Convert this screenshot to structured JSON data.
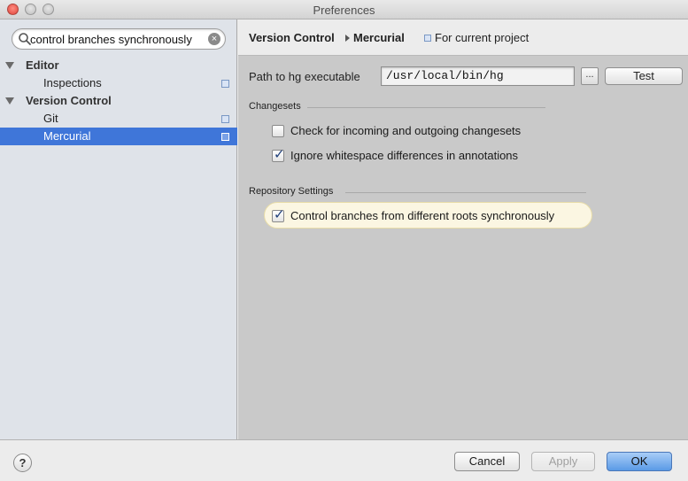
{
  "window": {
    "title": "Preferences"
  },
  "search": {
    "value": "control branches synchronously",
    "icon": "search-icon"
  },
  "tree": {
    "items": [
      {
        "label": "Editor",
        "level": 0,
        "expanded": true
      },
      {
        "label": "Inspections",
        "level": 1,
        "project_icon": true
      },
      {
        "label": "Version Control",
        "level": 0,
        "expanded": true
      },
      {
        "label": "Git",
        "level": 1,
        "project_icon": true
      },
      {
        "label": "Mercurial",
        "level": 1,
        "project_icon": true,
        "selected": true
      }
    ]
  },
  "header": {
    "breadcrumb_parent": "Version Control",
    "breadcrumb_current": "Mercurial",
    "scope": "For current project"
  },
  "hg": {
    "path_label": "Path to hg executable",
    "path_value": "/usr/local/bin/hg",
    "browse_label": "...",
    "test_label": "Test"
  },
  "changesets": {
    "title": "Changesets",
    "incoming_label": "Check for incoming and outgoing changesets",
    "incoming_checked": false,
    "whitespace_label": "Ignore whitespace differences in annotations",
    "whitespace_checked": true
  },
  "repository": {
    "title": "Repository Settings",
    "sync_label": "Control branches from different roots synchronously",
    "sync_checked": true
  },
  "footer": {
    "help_label": "?",
    "cancel_label": "Cancel",
    "apply_label": "Apply",
    "ok_label": "OK"
  },
  "colors": {
    "selection": "#3f76d9",
    "sidebar": "#dfe3e9",
    "panel": "#c9c9c9",
    "highlight": "#fbf6e2",
    "ok_button": "#5a9ae6"
  }
}
